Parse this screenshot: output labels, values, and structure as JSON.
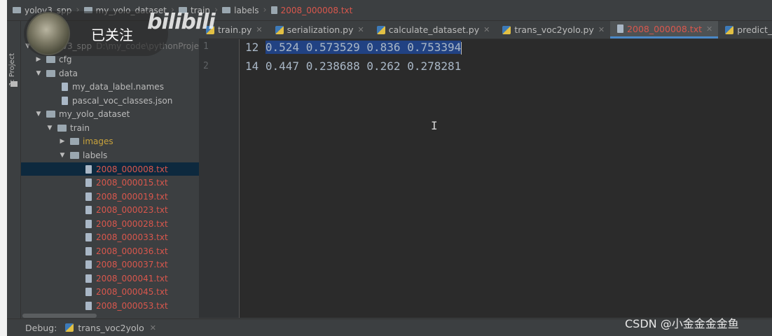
{
  "breadcrumb": [
    {
      "label": "yolov3_spp",
      "icon": "folder-icon"
    },
    {
      "label": "my_yolo_dataset",
      "icon": "folder-icon"
    },
    {
      "label": "train",
      "icon": "folder-icon"
    },
    {
      "label": "labels",
      "icon": "folder-icon"
    },
    {
      "label": "2008_000008.txt",
      "icon": "text-file-icon",
      "active": true
    }
  ],
  "tool_window": {
    "project_label": "1: Project"
  },
  "tree": {
    "root": {
      "label": "yolov3_spp",
      "path": "D:\\my_code\\pythonProje"
    },
    "items": [
      {
        "label": "cfg",
        "type": "folder",
        "expanded": false
      },
      {
        "label": "data",
        "type": "folder",
        "expanded": true
      },
      {
        "label": "my_data_label.names",
        "type": "file"
      },
      {
        "label": "pascal_voc_classes.json",
        "type": "file"
      },
      {
        "label": "my_yolo_dataset",
        "type": "folder",
        "expanded": true
      },
      {
        "label": "train",
        "type": "folder",
        "expanded": true
      },
      {
        "label": "images",
        "type": "folder",
        "expanded": false
      },
      {
        "label": "labels",
        "type": "folder",
        "expanded": true
      }
    ],
    "label_files": [
      "2008_000008.txt",
      "2008_000015.txt",
      "2008_000019.txt",
      "2008_000023.txt",
      "2008_000028.txt",
      "2008_000033.txt",
      "2008_000036.txt",
      "2008_000037.txt",
      "2008_000041.txt",
      "2008_000045.txt",
      "2008_000053.txt"
    ]
  },
  "tabs": [
    {
      "label": "train.py",
      "icon": "python-file-icon"
    },
    {
      "label": "serialization.py",
      "icon": "python-file-icon"
    },
    {
      "label": "calculate_dataset.py",
      "icon": "python-file-icon"
    },
    {
      "label": "trans_voc2yolo.py",
      "icon": "python-file-icon"
    },
    {
      "label": "2008_000008.txt",
      "icon": "text-file-icon",
      "active": true
    },
    {
      "label": "predict_test.py",
      "icon": "python-file-icon"
    }
  ],
  "editor": {
    "lines": [
      {
        "number": "1",
        "prefix": "12 ",
        "selected": "0.524 0.573529 0.836 0.753394"
      },
      {
        "number": "2",
        "prefix": "14 0.447 0.238688 0.262 0.278281",
        "selected": ""
      }
    ]
  },
  "debug_bar": {
    "label": "Debug:",
    "config": "trans_voc2yolo"
  },
  "overlay": {
    "follow_text": "已关注",
    "bili_text": "bilibili",
    "csdn_text": "CSDN @小金金金金鱼"
  },
  "colors": {
    "accent": "#4a88c7",
    "selection": "#214283",
    "vcs_untracked": "#d9574d",
    "ignored": "#c8a23c"
  }
}
